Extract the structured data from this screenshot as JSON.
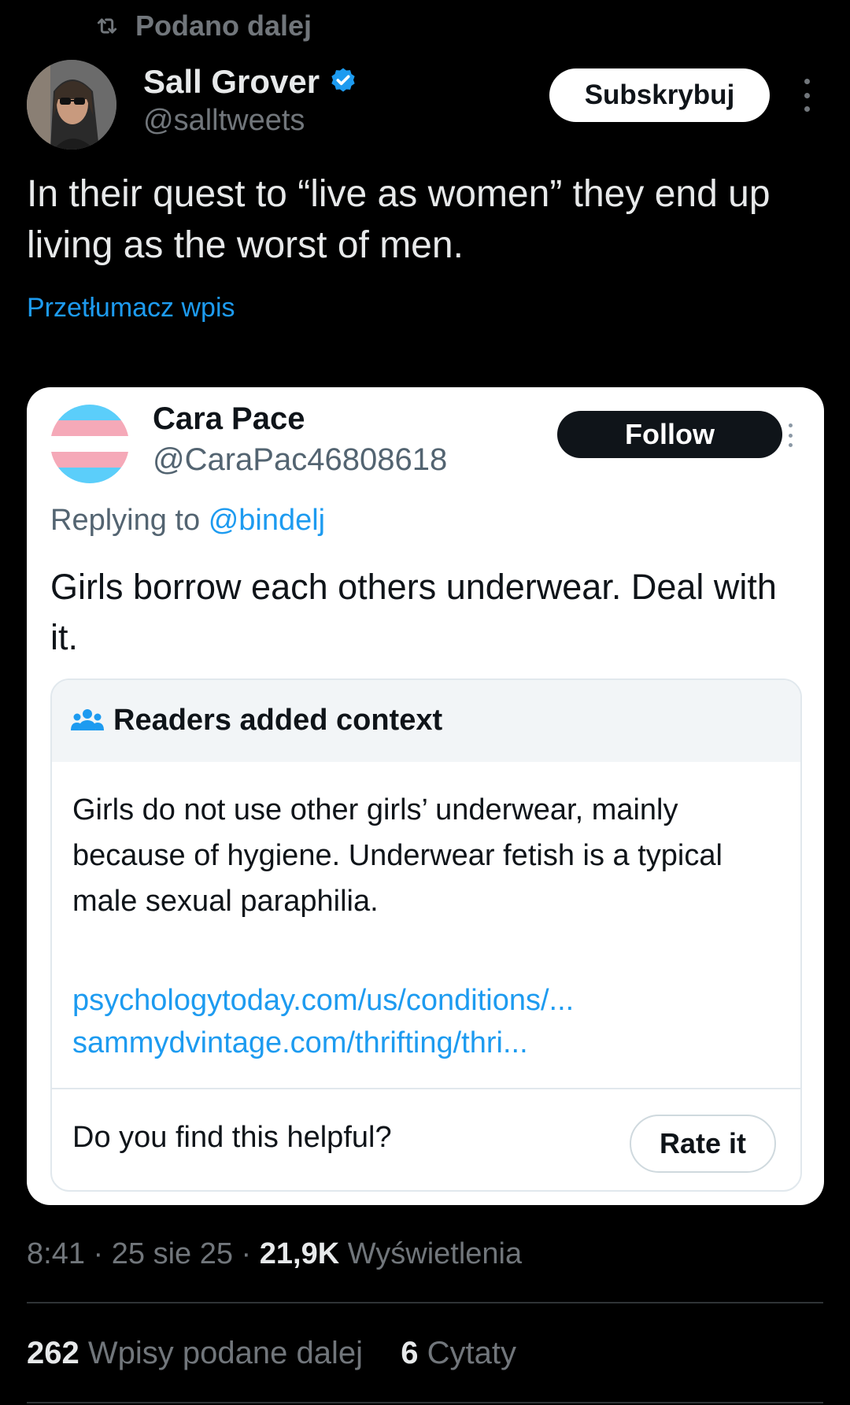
{
  "repost": {
    "label": "Podano dalej"
  },
  "author": {
    "name": "Sall Grover",
    "handle": "@salltweets",
    "verified": true
  },
  "subscribe_label": "Subskrybuj",
  "tweet_text": "In their quest to “live as women” they end up living as the worst of men.",
  "translate_label": "Przetłumacz wpis",
  "embedded": {
    "name": "Cara Pace",
    "handle": "@CaraPac46808618",
    "follow_label": "Follow",
    "replying_prefix": "Replying to",
    "replying_to": "@bindelj",
    "text": "Girls borrow each others underwear. Deal with it.",
    "context": {
      "title": "Readers added context",
      "body": "Girls do not use other girls’ underwear, mainly because of hygiene. Underwear fetish is a typical male sexual paraphilia.",
      "links": [
        "psychologytoday.com/us/conditions/...",
        "sammydvintage.com/thrifting/thri..."
      ],
      "helpful_question": "Do you find this helpful?",
      "rate_label": "Rate it"
    }
  },
  "meta": {
    "time": "8:41",
    "date": "25 sie 25",
    "views_count": "21,9K",
    "views_label": "Wyświetlenia"
  },
  "stats": {
    "reposts_count": "262",
    "reposts_label": "Wpisy podane dalej",
    "quotes_count": "6",
    "quotes_label": "Cytaty"
  },
  "colors": {
    "background": "#000000",
    "link": "#1d9bf0",
    "muted": "#71767b",
    "verified": "#1d9bf0",
    "flag_blue": "#5bcefa",
    "flag_pink": "#f5a9b8"
  },
  "icons": [
    "repost-icon",
    "verified-badge-icon",
    "more-options-icon",
    "readers-context-icon"
  ]
}
